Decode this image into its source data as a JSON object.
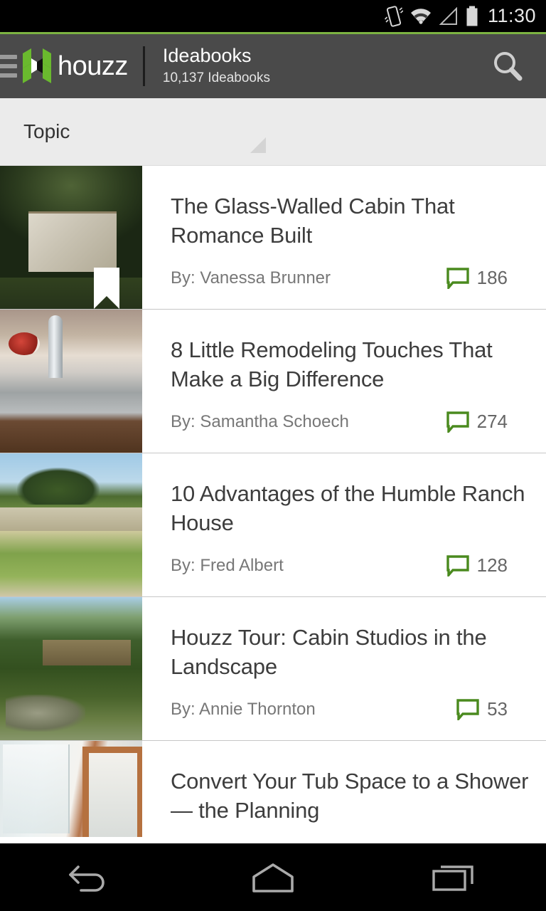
{
  "statusbar": {
    "time": "11:30",
    "icons": [
      "vibrate-icon",
      "wifi-icon",
      "cellular-signal-icon",
      "battery-icon"
    ]
  },
  "actionbar": {
    "menu_icon": "hamburger-menu-icon",
    "logo_text": "houzz",
    "title": "Ideabooks",
    "subtitle": "10,137 Ideabooks",
    "search_icon": "search-icon"
  },
  "filterbar": {
    "label": "Topic",
    "indicator_icon": "spinner-triangle-icon"
  },
  "colors": {
    "accent_green": "#7cb342",
    "logo_green": "#6aba2e",
    "comment_green": "#4a8a1e",
    "actionbar_bg": "#4a4a4a",
    "filterbar_bg": "#ebebeb",
    "title_text": "#3d3d3d",
    "author_text": "#777777"
  },
  "list": {
    "items": [
      {
        "title": "The Glass-Walled Cabin That Romance Built",
        "author": "By: Vanessa Brunner",
        "comments": "186",
        "bookmarked": true,
        "thumb": "cabin-with-glass-windows-photo"
      },
      {
        "title": "8 Little Remodeling Touches That Make a Big Difference",
        "author": "By: Samantha Schoech",
        "comments": "274",
        "bookmarked": false,
        "thumb": "kitchen-sink-photo"
      },
      {
        "title": "10 Advantages of the Humble Ranch House",
        "author": "By: Fred Albert",
        "comments": "128",
        "bookmarked": false,
        "thumb": "ranch-house-exterior-photo"
      },
      {
        "title": "Houzz Tour: Cabin Studios in the Landscape",
        "author": "By: Annie Thornton",
        "comments": "53",
        "bookmarked": false,
        "thumb": "forest-cabin-studio-photo"
      },
      {
        "title": "Convert Your Tub Space to a Shower — the Planning",
        "author": "",
        "comments": "",
        "bookmarked": false,
        "thumb": "bathroom-shower-photo"
      }
    ]
  },
  "navbar": {
    "back_label": "back-icon",
    "home_label": "home-icon",
    "recents_label": "recent-apps-icon"
  }
}
